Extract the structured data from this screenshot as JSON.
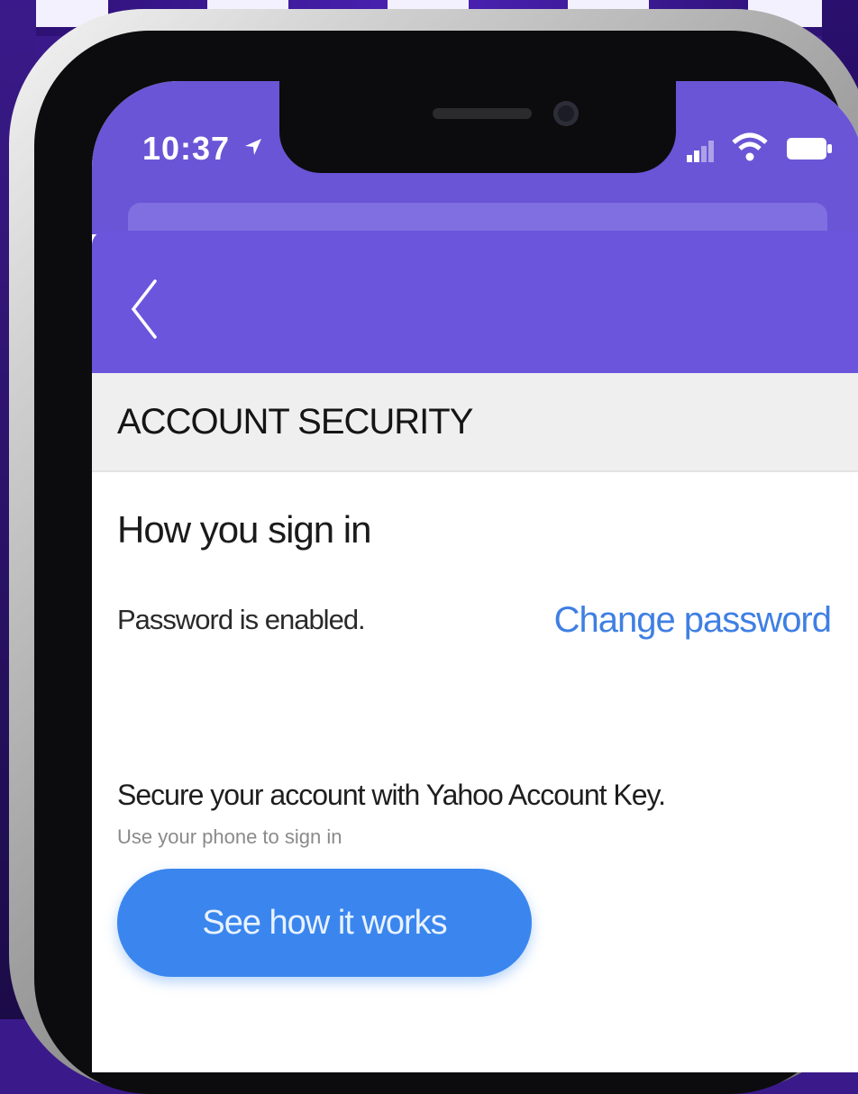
{
  "status_bar": {
    "time": "10:37",
    "icons": [
      "location-arrow-icon",
      "signal-icon",
      "wifi-icon",
      "battery-icon"
    ]
  },
  "header": {
    "back_icon": "chevron-left-icon"
  },
  "section": {
    "title": "ACCOUNT SECURITY"
  },
  "signin": {
    "heading": "How you sign in",
    "password_status": "Password is enabled.",
    "change_password_link": "Change password"
  },
  "account_key": {
    "title": "Secure your account with Yahoo Account Key.",
    "subtitle": "Use your phone to sign in",
    "button_label": "See how it works"
  },
  "colors": {
    "header_purple": "#6a55dc",
    "link_blue": "#3f7fe3",
    "button_blue": "#3a86ee",
    "section_gray": "#efefef"
  }
}
